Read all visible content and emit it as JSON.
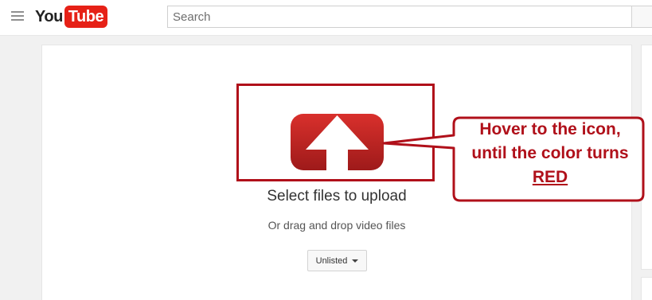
{
  "header": {
    "logo_you": "You",
    "logo_tube": "Tube",
    "search_placeholder": "Search"
  },
  "upload": {
    "title": "Select files to upload",
    "subtitle": "Or drag and drop video files",
    "privacy_value": "Unlisted"
  },
  "callout": {
    "line1": "Hover to the icon,",
    "line2": "until the color turns",
    "line3": "RED"
  },
  "colors": {
    "brand_red": "#e62117",
    "annotation_red": "#b0101a",
    "icon_red_top": "#d9302c",
    "icon_red_bottom": "#9e1a1a"
  },
  "icons": {
    "menu": "hamburger-icon",
    "upload": "upload-arrow-icon"
  }
}
